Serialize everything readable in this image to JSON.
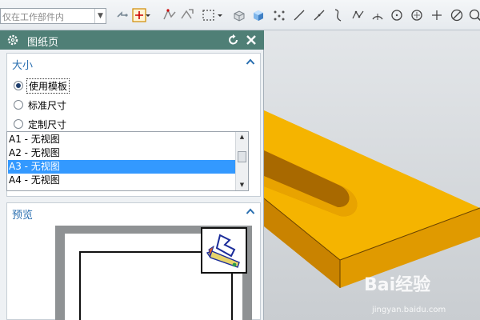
{
  "toolbar": {
    "filter_value": "仅在工作部件内",
    "icons": [
      "snap-point-icon",
      "point-constructor-icon",
      "curve-on-face-icon",
      "rectangle-select-icon",
      "box-select-icon",
      "solid-icon",
      "shaded-solid-icon",
      "network-icon",
      "line-icon",
      "line-alt-icon",
      "spline-icon",
      "studio-spline-icon",
      "arc-icon",
      "circle-icon",
      "plus-point-icon",
      "no-entry-icon",
      "search-icon"
    ]
  },
  "dialog": {
    "title": "图纸页",
    "size_section": {
      "title": "大小",
      "options": [
        "使用模板",
        "标准尺寸",
        "定制尺寸"
      ],
      "selected_option": "使用模板",
      "list_items": [
        "A1 - 无视图",
        "A2 - 无视图",
        "A3 - 无视图",
        "A4 - 无视图"
      ],
      "selected_item": "A3 - 无视图"
    },
    "preview_section": {
      "title": "预览"
    }
  },
  "watermark": {
    "brand": "Bai经验",
    "site": "jingyan.baidu.com"
  },
  "colors": {
    "dialog_title_bg": "#4f7f76",
    "section_title": "#2a6fb0",
    "list_selection": "#3399ff",
    "model_top": "#f5b400",
    "model_side": "#c98300"
  }
}
